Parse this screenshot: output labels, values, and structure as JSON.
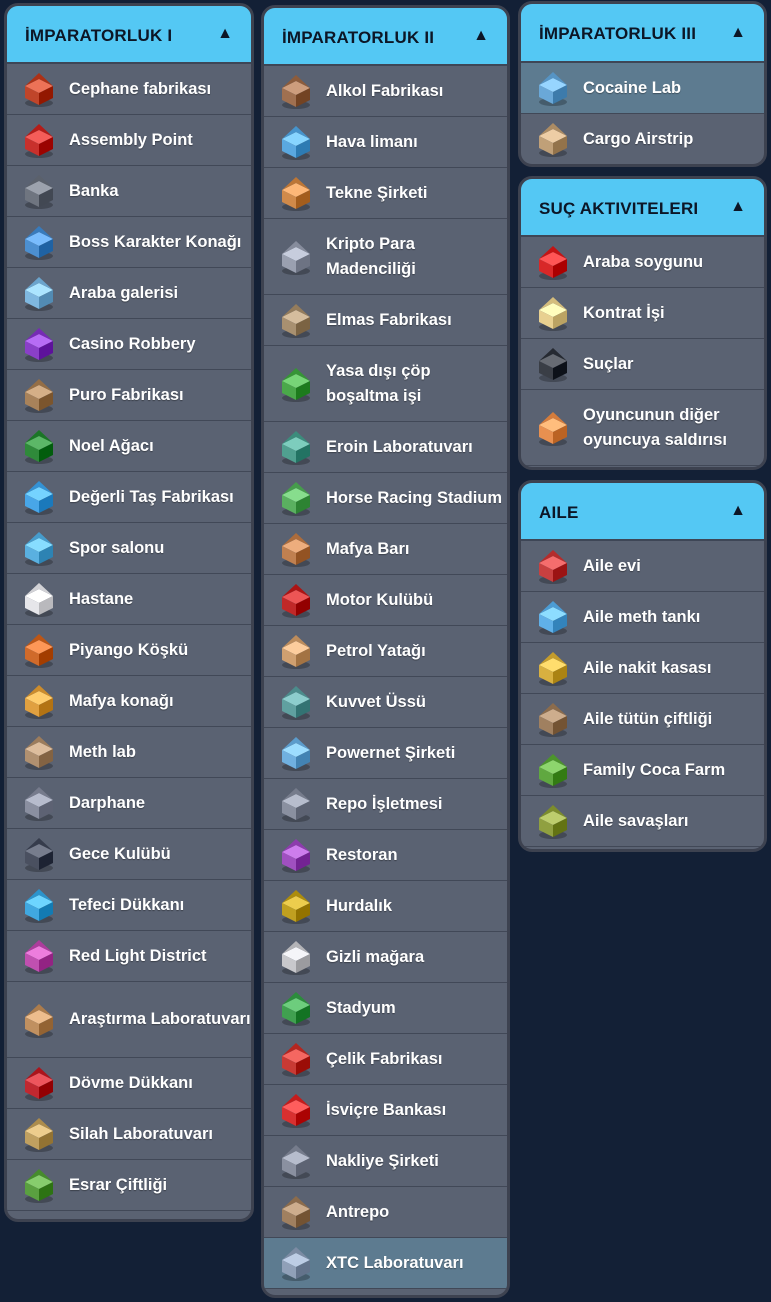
{
  "colors": {
    "background": "#132036",
    "header": "#54c8f4",
    "row": "#5a6272",
    "row_selected": "#5d7b90",
    "border": "#3d4250"
  },
  "caret_symbol": "▲",
  "panels": {
    "emp1": {
      "title": "İMPARATORLUK I",
      "items": [
        {
          "label": "Cephane fabrikası",
          "icon": "ammo-factory-icon",
          "tone": "#c0452a"
        },
        {
          "label": "Assembly Point",
          "icon": "assembly-point-icon",
          "tone": "#c8302c"
        },
        {
          "label": "Banka",
          "icon": "bank-icon",
          "tone": "#6f7580"
        },
        {
          "label": "Boss Karakter Konağı",
          "icon": "boss-mansion-icon",
          "tone": "#4c8fd0"
        },
        {
          "label": "Araba galerisi",
          "icon": "car-gallery-icon",
          "tone": "#7fb8e0"
        },
        {
          "label": "Casino Robbery",
          "icon": "casino-icon",
          "tone": "#8a3fc8"
        },
        {
          "label": "Puro Fabrikası",
          "icon": "cigar-factory-icon",
          "tone": "#a8825a"
        },
        {
          "label": "Noel Ağacı",
          "icon": "christmas-tree-icon",
          "tone": "#2f8a3a"
        },
        {
          "label": "Değerli Taş Fabrikası",
          "icon": "gem-factory-icon",
          "tone": "#48a6e8"
        },
        {
          "label": "Spor salonu",
          "icon": "gym-icon",
          "tone": "#5ab0e0"
        },
        {
          "label": "Hastane",
          "icon": "hospital-icon",
          "tone": "#e6e6ea"
        },
        {
          "label": "Piyango Köşkü",
          "icon": "lottery-kiosk-icon",
          "tone": "#d06a2a"
        },
        {
          "label": "Mafya konağı",
          "icon": "mafia-mansion-icon",
          "tone": "#e0a040"
        },
        {
          "label": "Meth lab",
          "icon": "meth-lab-icon",
          "tone": "#b09070"
        },
        {
          "label": "Darphane",
          "icon": "mint-icon",
          "tone": "#8a8fa0"
        },
        {
          "label": "Gece Kulübü",
          "icon": "night-club-icon",
          "tone": "#4a5060"
        },
        {
          "label": "Tefeci Dükkanı",
          "icon": "pawn-shop-icon",
          "tone": "#40a8e0"
        },
        {
          "label": "Red Light District",
          "icon": "red-light-district-icon",
          "tone": "#c050b0"
        },
        {
          "label": "Araştırma Laboratuvarı",
          "icon": "research-lab-icon",
          "tone": "#c09060",
          "tall": true
        },
        {
          "label": "Dövme Dükkanı",
          "icon": "tattoo-shop-icon",
          "tone": "#c02830"
        },
        {
          "label": "Silah Laboratuvarı",
          "icon": "weapon-lab-icon",
          "tone": "#c0a060"
        },
        {
          "label": "Esrar Çiftliği",
          "icon": "weed-farm-icon",
          "tone": "#5aa040"
        }
      ]
    },
    "emp2": {
      "title": "İMPARATORLUK II",
      "items": [
        {
          "label": "Alkol Fabrikası",
          "icon": "alcohol-factory-icon",
          "tone": "#a07050"
        },
        {
          "label": "Hava limanı",
          "icon": "airport-icon",
          "tone": "#5aa8e0"
        },
        {
          "label": "Tekne Şirketi",
          "icon": "boat-company-icon",
          "tone": "#d08a4a"
        },
        {
          "label": "Kripto Para Madenciliği",
          "icon": "crypto-mining-icon",
          "tone": "#9aa0b0",
          "tall": true
        },
        {
          "label": "Elmas Fabrikası",
          "icon": "diamond-factory-icon",
          "tone": "#a89070"
        },
        {
          "label": "Yasa dışı çöp boşaltma işi",
          "icon": "illegal-dumping-icon",
          "tone": "#4aa84a",
          "tall": true
        },
        {
          "label": "Eroin Laboratuvarı",
          "icon": "heroin-lab-icon",
          "tone": "#50a090"
        },
        {
          "label": "Horse Racing Stadium",
          "icon": "horse-racing-icon",
          "tone": "#5ab060"
        },
        {
          "label": "Mafya Barı",
          "icon": "mafia-bar-icon",
          "tone": "#c08050"
        },
        {
          "label": "Motor Kulübü",
          "icon": "motor-club-icon",
          "tone": "#c02828"
        },
        {
          "label": "Petrol Yatağı",
          "icon": "oil-field-icon",
          "tone": "#d0a070"
        },
        {
          "label": "Kuvvet Üssü",
          "icon": "force-base-icon",
          "tone": "#60a0a0"
        },
        {
          "label": "Powernet Şirketi",
          "icon": "powernet-icon",
          "tone": "#70b0e0"
        },
        {
          "label": "Repo İşletmesi",
          "icon": "repo-business-icon",
          "tone": "#8a90a0"
        },
        {
          "label": "Restoran",
          "icon": "restaurant-icon",
          "tone": "#a050c0"
        },
        {
          "label": "Hurdalık",
          "icon": "scrapyard-icon",
          "tone": "#c0a020"
        },
        {
          "label": "Gizli mağara",
          "icon": "secret-cave-icon",
          "tone": "#c8c8cc"
        },
        {
          "label": "Stadyum",
          "icon": "stadium-icon",
          "tone": "#40a050"
        },
        {
          "label": "Çelik Fabrikası",
          "icon": "steel-factory-icon",
          "tone": "#c83a34"
        },
        {
          "label": "İsviçre Bankası",
          "icon": "swiss-bank-icon",
          "tone": "#d83030"
        },
        {
          "label": "Nakliye Şirketi",
          "icon": "shipping-company-icon",
          "tone": "#8a90a0"
        },
        {
          "label": "Antrepo",
          "icon": "warehouse-icon",
          "tone": "#a08060"
        },
        {
          "label": "XTC Laboratuvarı",
          "icon": "xtc-lab-icon",
          "tone": "#90a0b8",
          "selected": true
        }
      ]
    },
    "emp3": {
      "title": "İMPARATORLUK III",
      "items": [
        {
          "label": "Cocaine Lab",
          "icon": "cocaine-lab-icon",
          "tone": "#6aa8d8",
          "selected": true
        },
        {
          "label": "Cargo Airstrip",
          "icon": "cargo-airstrip-icon",
          "tone": "#c0a078"
        }
      ]
    },
    "crime": {
      "title": "SUÇ AKTIVITELERI",
      "items": [
        {
          "label": "Araba soygunu",
          "icon": "car-theft-icon",
          "tone": "#d82828"
        },
        {
          "label": "Kontrat İşi",
          "icon": "contract-icon",
          "tone": "#e8d090"
        },
        {
          "label": "Suçlar",
          "icon": "gun-icon",
          "tone": "#3a3e46"
        },
        {
          "label": "Oyuncunun diğer oyuncuya saldırısı",
          "icon": "attack-fist-icon",
          "tone": "#e89050",
          "tall": true
        }
      ]
    },
    "family": {
      "title": "AILE",
      "items": [
        {
          "label": "Aile evi",
          "icon": "family-house-icon",
          "tone": "#c84040"
        },
        {
          "label": "Aile meth tankı",
          "icon": "meth-tank-icon",
          "tone": "#60b0e8"
        },
        {
          "label": "Aile nakit kasası",
          "icon": "cash-vault-icon",
          "tone": "#d8b040"
        },
        {
          "label": "Aile tütün çiftliği",
          "icon": "tobacco-farm-icon",
          "tone": "#a08060"
        },
        {
          "label": "Family Coca Farm",
          "icon": "coca-farm-icon",
          "tone": "#60a840"
        },
        {
          "label": "Aile savaşları",
          "icon": "family-wars-icon",
          "tone": "#90a040"
        }
      ]
    }
  }
}
